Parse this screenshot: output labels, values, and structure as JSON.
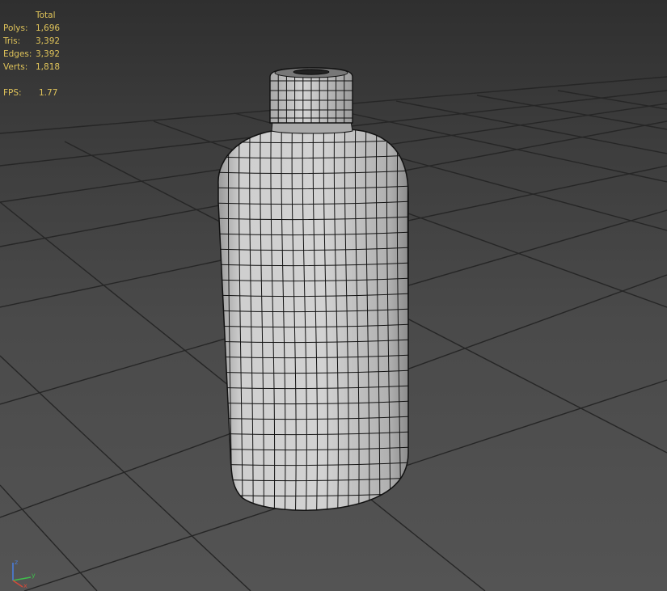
{
  "viewport": {
    "stats": {
      "header": "Total",
      "rows": [
        {
          "label": "Polys:",
          "value": "1,696"
        },
        {
          "label": "Tris:",
          "value": "3,392"
        },
        {
          "label": "Edges:",
          "value": "3,392"
        },
        {
          "label": "Verts:",
          "value": "1,818"
        }
      ],
      "fps": {
        "label": "FPS:",
        "value": "1.77"
      }
    },
    "axis_tripod": {
      "x_label": "x",
      "y_label": "y",
      "z_label": "z"
    },
    "colors": {
      "stats_text": "#e0c45a",
      "grid_line": "#262626",
      "model_fill": "#c7c7c7",
      "wire": "#111111",
      "axis_x": "#d24a3a",
      "axis_y": "#3fbf4c",
      "axis_z": "#4a7ddb"
    },
    "object": "bottle-mesh"
  }
}
